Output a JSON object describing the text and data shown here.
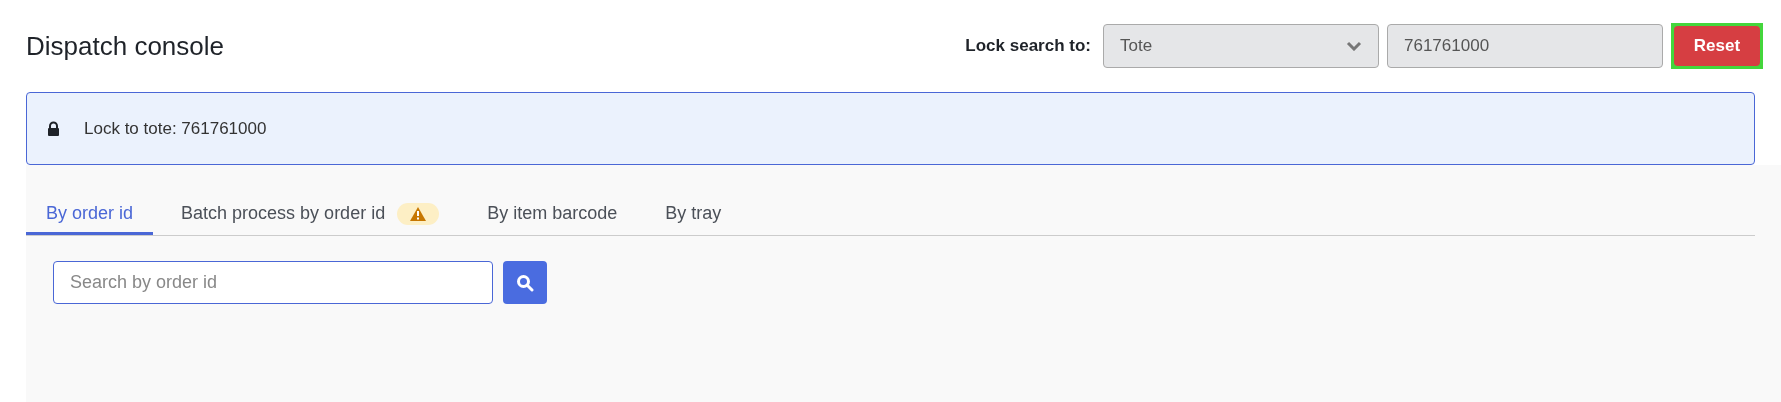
{
  "page": {
    "title": "Dispatch console"
  },
  "lock_search": {
    "label": "Lock search to:",
    "type_select": {
      "value": "Tote"
    },
    "value_field": {
      "value": "761761000"
    },
    "reset_button": {
      "label": "Reset",
      "focused": true
    }
  },
  "banner": {
    "text": "Lock to tote: 761761000"
  },
  "tabs": [
    {
      "label": "By order id",
      "selected": true,
      "warning": false
    },
    {
      "label": "Batch process by order id",
      "selected": false,
      "warning": true
    },
    {
      "label": "By item barcode",
      "selected": false,
      "warning": false
    },
    {
      "label": "By tray",
      "selected": false,
      "warning": false
    }
  ],
  "search": {
    "placeholder": "Search by order id"
  }
}
